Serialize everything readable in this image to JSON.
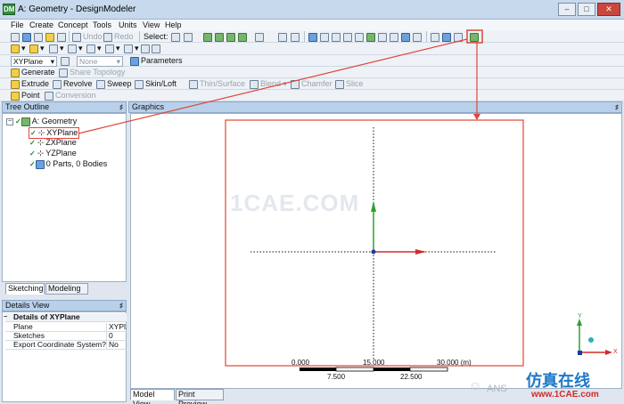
{
  "window": {
    "title": "A: Geometry - DesignModeler",
    "minimize": "–",
    "maximize": "□",
    "close": "✕"
  },
  "menu": [
    "File",
    "Create",
    "Concept",
    "Tools",
    "Units",
    "View",
    "Help"
  ],
  "toolbar1": {
    "select_label": "Select:",
    "undo": "Undo",
    "redo": "Redo"
  },
  "toolbar3": {
    "plane_value": "XYPlane",
    "sketch_value": "None",
    "parameters": "Parameters"
  },
  "toolbar4": {
    "generate": "Generate",
    "share_topology": "Share Topology"
  },
  "toolbar5": {
    "extrude": "Extrude",
    "revolve": "Revolve",
    "sweep": "Sweep",
    "skin_loft": "Skin/Loft",
    "thin_surface": "Thin/Surface",
    "blend": "Blend",
    "chamfer": "Chamfer",
    "slice": "Slice"
  },
  "toolbar6": {
    "point": "Point",
    "conversion": "Conversion"
  },
  "tree": {
    "header": "Tree Outline",
    "pin": "♯",
    "root": "A: Geometry",
    "items": [
      "XYPlane",
      "ZXPlane",
      "YZPlane",
      "0 Parts, 0 Bodies"
    ],
    "tabs": [
      "Sketching",
      "Modeling"
    ]
  },
  "details": {
    "header": "Details View",
    "pin": "♯",
    "title": "Details of XYPlane",
    "rows": [
      {
        "label": "Plane",
        "value": "XYPl..."
      },
      {
        "label": "Sketches",
        "value": "0"
      },
      {
        "label": "Export Coordinate System?",
        "value": "No"
      }
    ]
  },
  "graphics": {
    "header": "Graphics",
    "pin": "♯",
    "watermark": "1CAE.COM",
    "scale_top": [
      "0.000",
      "15.000",
      "30.000 (m)"
    ],
    "scale_bottom": [
      "7.500",
      "22.500"
    ],
    "triad": {
      "y": "Y",
      "x": "X"
    },
    "tabs": [
      "Model View",
      "Print Preview"
    ],
    "brand": "仿真在线",
    "brand_url": "www.1CAE.com",
    "brand_text": "ANS"
  },
  "colors": {
    "highlight": "#e0463a",
    "axis_green": "#2ea02e",
    "axis_red": "#d22a2a",
    "brand_blue": "#1e78c8"
  }
}
